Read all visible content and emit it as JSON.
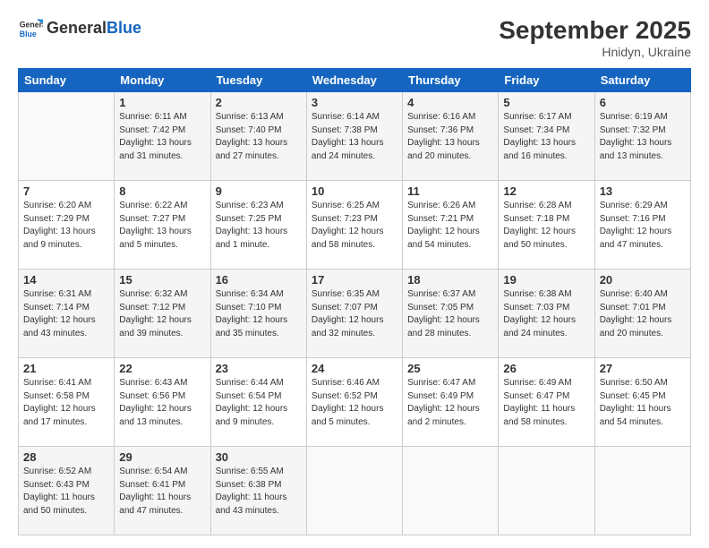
{
  "logo": {
    "general": "General",
    "blue": "Blue"
  },
  "header": {
    "month": "September 2025",
    "location": "Hnidyn, Ukraine"
  },
  "weekdays": [
    "Sunday",
    "Monday",
    "Tuesday",
    "Wednesday",
    "Thursday",
    "Friday",
    "Saturday"
  ],
  "weeks": [
    [
      {
        "day": "",
        "info": ""
      },
      {
        "day": "1",
        "info": "Sunrise: 6:11 AM\nSunset: 7:42 PM\nDaylight: 13 hours\nand 31 minutes."
      },
      {
        "day": "2",
        "info": "Sunrise: 6:13 AM\nSunset: 7:40 PM\nDaylight: 13 hours\nand 27 minutes."
      },
      {
        "day": "3",
        "info": "Sunrise: 6:14 AM\nSunset: 7:38 PM\nDaylight: 13 hours\nand 24 minutes."
      },
      {
        "day": "4",
        "info": "Sunrise: 6:16 AM\nSunset: 7:36 PM\nDaylight: 13 hours\nand 20 minutes."
      },
      {
        "day": "5",
        "info": "Sunrise: 6:17 AM\nSunset: 7:34 PM\nDaylight: 13 hours\nand 16 minutes."
      },
      {
        "day": "6",
        "info": "Sunrise: 6:19 AM\nSunset: 7:32 PM\nDaylight: 13 hours\nand 13 minutes."
      }
    ],
    [
      {
        "day": "7",
        "info": "Sunrise: 6:20 AM\nSunset: 7:29 PM\nDaylight: 13 hours\nand 9 minutes."
      },
      {
        "day": "8",
        "info": "Sunrise: 6:22 AM\nSunset: 7:27 PM\nDaylight: 13 hours\nand 5 minutes."
      },
      {
        "day": "9",
        "info": "Sunrise: 6:23 AM\nSunset: 7:25 PM\nDaylight: 13 hours\nand 1 minute."
      },
      {
        "day": "10",
        "info": "Sunrise: 6:25 AM\nSunset: 7:23 PM\nDaylight: 12 hours\nand 58 minutes."
      },
      {
        "day": "11",
        "info": "Sunrise: 6:26 AM\nSunset: 7:21 PM\nDaylight: 12 hours\nand 54 minutes."
      },
      {
        "day": "12",
        "info": "Sunrise: 6:28 AM\nSunset: 7:18 PM\nDaylight: 12 hours\nand 50 minutes."
      },
      {
        "day": "13",
        "info": "Sunrise: 6:29 AM\nSunset: 7:16 PM\nDaylight: 12 hours\nand 47 minutes."
      }
    ],
    [
      {
        "day": "14",
        "info": "Sunrise: 6:31 AM\nSunset: 7:14 PM\nDaylight: 12 hours\nand 43 minutes."
      },
      {
        "day": "15",
        "info": "Sunrise: 6:32 AM\nSunset: 7:12 PM\nDaylight: 12 hours\nand 39 minutes."
      },
      {
        "day": "16",
        "info": "Sunrise: 6:34 AM\nSunset: 7:10 PM\nDaylight: 12 hours\nand 35 minutes."
      },
      {
        "day": "17",
        "info": "Sunrise: 6:35 AM\nSunset: 7:07 PM\nDaylight: 12 hours\nand 32 minutes."
      },
      {
        "day": "18",
        "info": "Sunrise: 6:37 AM\nSunset: 7:05 PM\nDaylight: 12 hours\nand 28 minutes."
      },
      {
        "day": "19",
        "info": "Sunrise: 6:38 AM\nSunset: 7:03 PM\nDaylight: 12 hours\nand 24 minutes."
      },
      {
        "day": "20",
        "info": "Sunrise: 6:40 AM\nSunset: 7:01 PM\nDaylight: 12 hours\nand 20 minutes."
      }
    ],
    [
      {
        "day": "21",
        "info": "Sunrise: 6:41 AM\nSunset: 6:58 PM\nDaylight: 12 hours\nand 17 minutes."
      },
      {
        "day": "22",
        "info": "Sunrise: 6:43 AM\nSunset: 6:56 PM\nDaylight: 12 hours\nand 13 minutes."
      },
      {
        "day": "23",
        "info": "Sunrise: 6:44 AM\nSunset: 6:54 PM\nDaylight: 12 hours\nand 9 minutes."
      },
      {
        "day": "24",
        "info": "Sunrise: 6:46 AM\nSunset: 6:52 PM\nDaylight: 12 hours\nand 5 minutes."
      },
      {
        "day": "25",
        "info": "Sunrise: 6:47 AM\nSunset: 6:49 PM\nDaylight: 12 hours\nand 2 minutes."
      },
      {
        "day": "26",
        "info": "Sunrise: 6:49 AM\nSunset: 6:47 PM\nDaylight: 11 hours\nand 58 minutes."
      },
      {
        "day": "27",
        "info": "Sunrise: 6:50 AM\nSunset: 6:45 PM\nDaylight: 11 hours\nand 54 minutes."
      }
    ],
    [
      {
        "day": "28",
        "info": "Sunrise: 6:52 AM\nSunset: 6:43 PM\nDaylight: 11 hours\nand 50 minutes."
      },
      {
        "day": "29",
        "info": "Sunrise: 6:54 AM\nSunset: 6:41 PM\nDaylight: 11 hours\nand 47 minutes."
      },
      {
        "day": "30",
        "info": "Sunrise: 6:55 AM\nSunset: 6:38 PM\nDaylight: 11 hours\nand 43 minutes."
      },
      {
        "day": "",
        "info": ""
      },
      {
        "day": "",
        "info": ""
      },
      {
        "day": "",
        "info": ""
      },
      {
        "day": "",
        "info": ""
      }
    ]
  ]
}
